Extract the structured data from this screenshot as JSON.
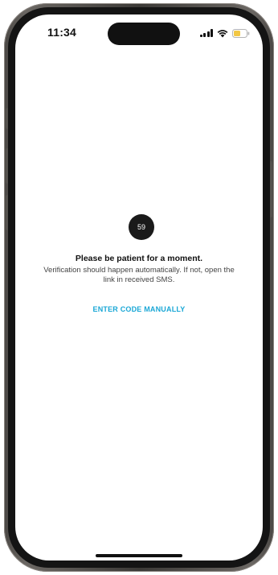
{
  "status_bar": {
    "time": "11:34",
    "battery_color": "#f2c744"
  },
  "verification": {
    "timer": "59",
    "title": "Please be patient for a moment.",
    "message": "Verification should happen automatically. If not, open the link in received SMS.",
    "enter_code_label": "ENTER CODE MANUALLY"
  },
  "colors": {
    "accent": "#1aa7d6",
    "badge": "#1a1a1a"
  },
  "icons": [
    "signal-icon",
    "wifi-icon",
    "battery-icon"
  ]
}
